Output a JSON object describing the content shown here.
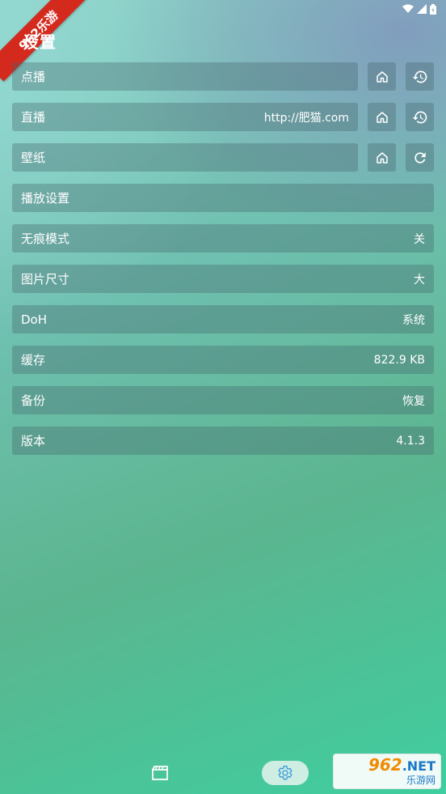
{
  "header": {
    "title": "设置"
  },
  "ribbon": {
    "text": "962乐游"
  },
  "settings": [
    {
      "label": "点播",
      "value": "",
      "buttons": [
        "home-icon",
        "history-icon"
      ]
    },
    {
      "label": "直播",
      "value": "http://肥猫.com",
      "buttons": [
        "home-icon",
        "history-icon"
      ]
    },
    {
      "label": "壁纸",
      "value": "",
      "buttons": [
        "home-icon",
        "refresh-icon"
      ]
    },
    {
      "label": "播放设置",
      "value": ""
    },
    {
      "label": "无痕模式",
      "value": "关"
    },
    {
      "label": "图片尺寸",
      "value": "大"
    },
    {
      "label": "DoH",
      "value": "系统"
    },
    {
      "label": "缓存",
      "value": "822.9 KB"
    },
    {
      "label": "备份",
      "value": "恢复"
    },
    {
      "label": "版本",
      "value": "4.1.3"
    }
  ],
  "nav": {
    "items": [
      "film-icon",
      "settings-icon"
    ],
    "active": "settings-icon"
  },
  "watermark": {
    "main": "962",
    "net": ".NET",
    "sub": "乐游网"
  },
  "colors": {
    "accent": "#3a9ad9",
    "ribbon": "#d42a1e"
  }
}
